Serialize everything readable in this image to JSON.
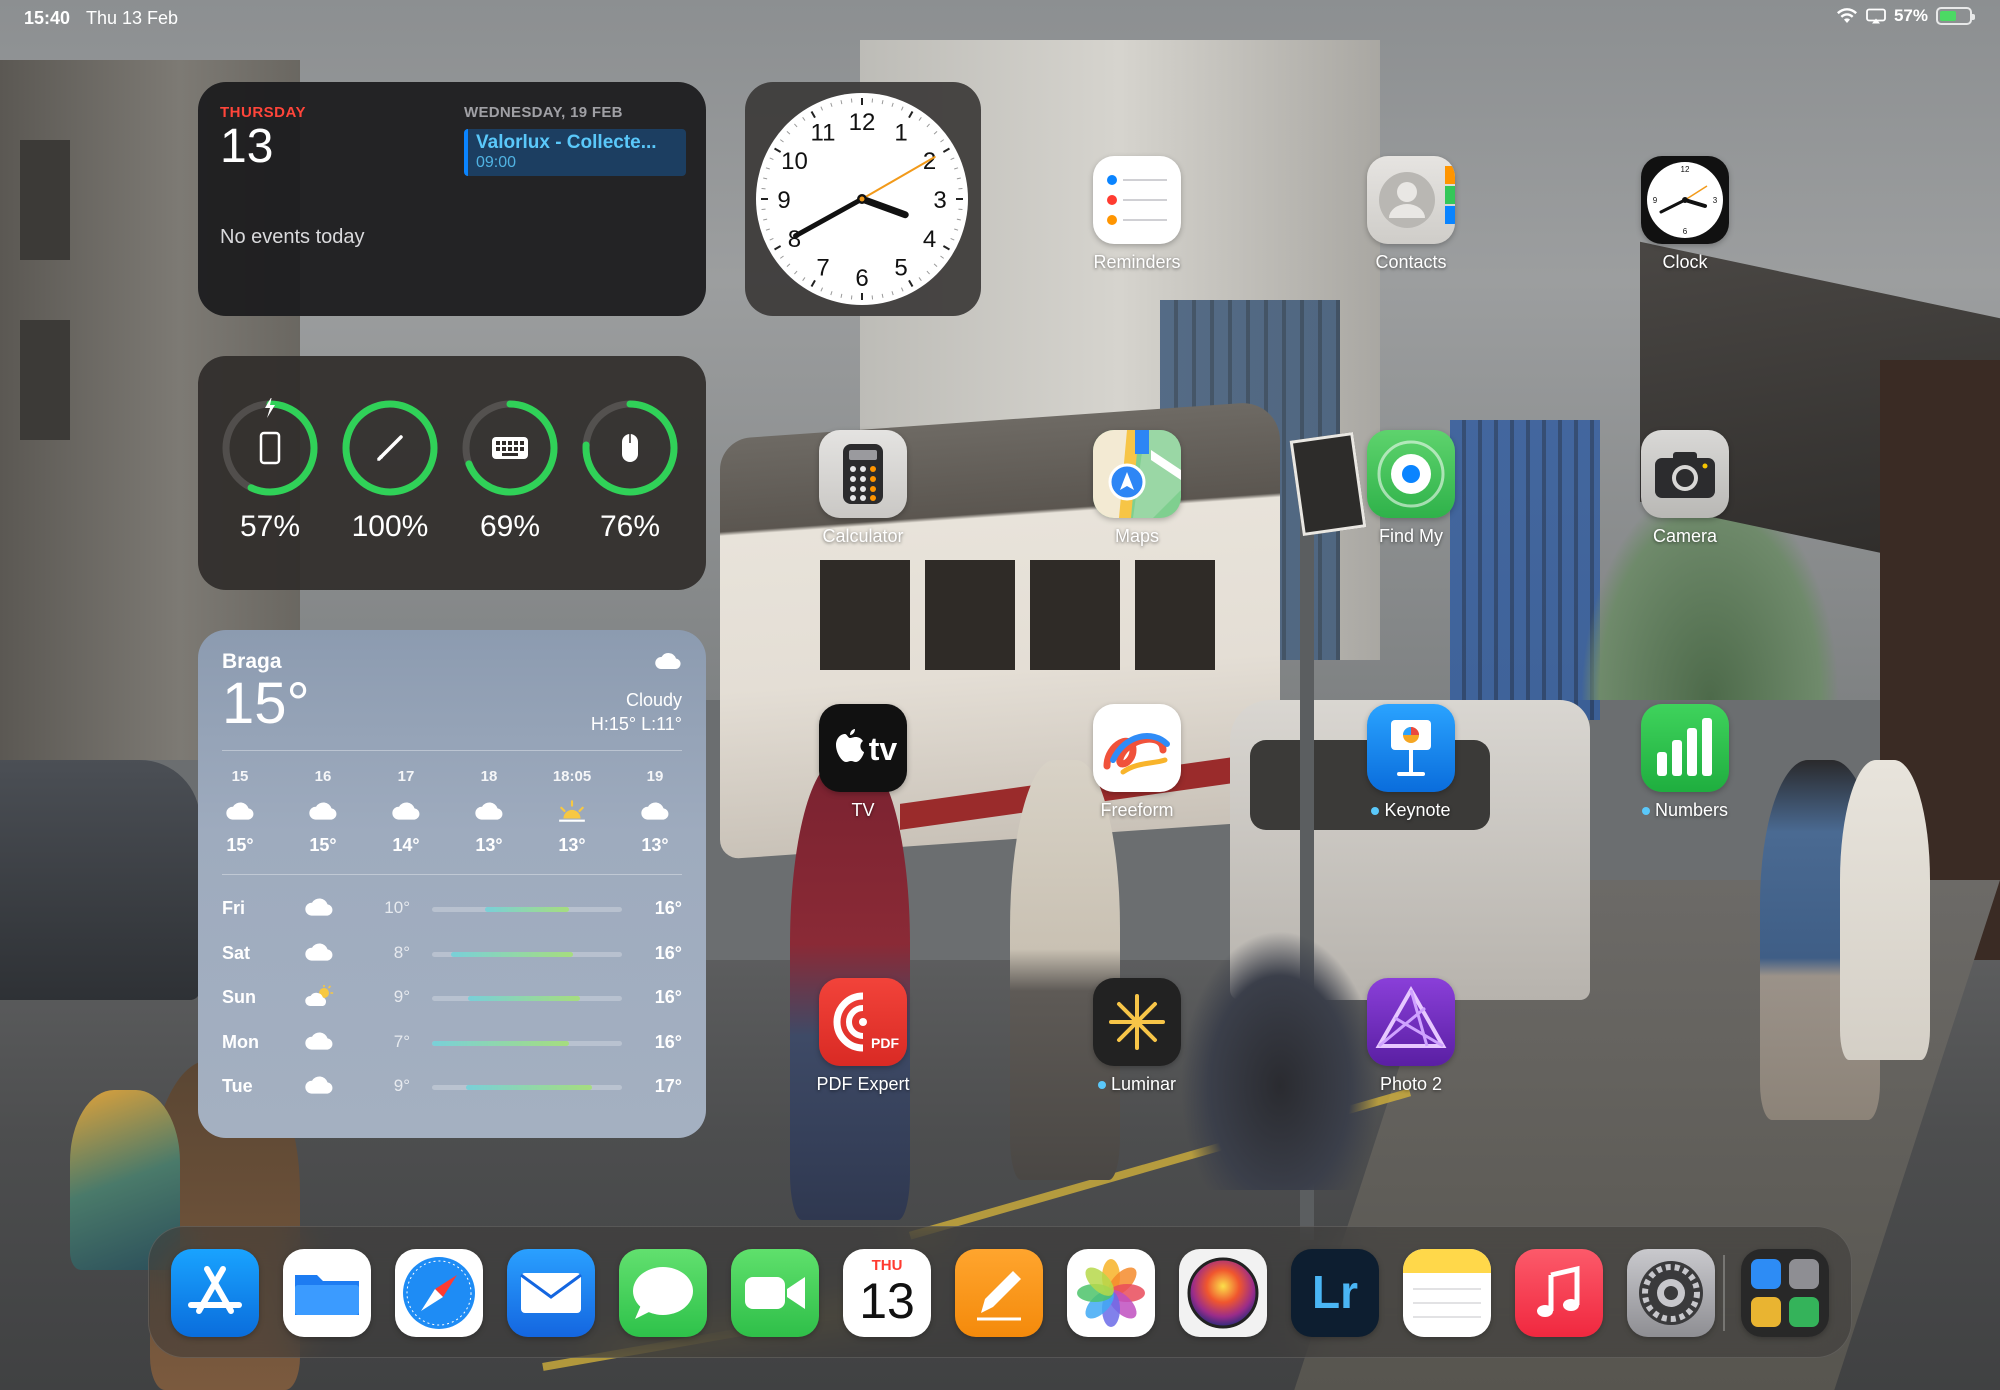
{
  "status_bar": {
    "time": "15:40",
    "date": "Thu 13 Feb",
    "battery_pct": "57%",
    "battery_level": 0.57,
    "icons": [
      "wifi-icon",
      "screen-mirroring-icon",
      "battery-charging-icon"
    ]
  },
  "calendar_widget": {
    "day_name": "THURSDAY",
    "day_number": "13",
    "empty_text": "No events today",
    "upcoming_date": "WEDNESDAY, 19 FEB",
    "event_title": "Valorlux - Collecte...",
    "event_time": "09:00",
    "accent": "#ff453a",
    "event_color": "#0a84ff"
  },
  "clock_widget": {
    "numbers": [
      "12",
      "1",
      "2",
      "3",
      "4",
      "5",
      "6",
      "7",
      "8",
      "9",
      "10",
      "11"
    ],
    "hour": 15,
    "minute": 40,
    "second": 10
  },
  "batteries_widget": {
    "devices": [
      {
        "name": "ipad-icon",
        "pct_text": "57%",
        "level": 0.57,
        "charging": true
      },
      {
        "name": "pencil-icon",
        "pct_text": "100%",
        "level": 1.0,
        "charging": false
      },
      {
        "name": "keyboard-icon",
        "pct_text": "69%",
        "level": 0.69,
        "charging": false
      },
      {
        "name": "mouse-icon",
        "pct_text": "76%",
        "level": 0.76,
        "charging": false
      }
    ],
    "ring_color": "#30d158"
  },
  "weather_widget": {
    "city": "Braga",
    "temperature": "15°",
    "condition": "Cloudy",
    "high_low": "H:15° L:11°",
    "hourly": [
      {
        "time": "15",
        "icon": "cloud-icon",
        "temp": "15°"
      },
      {
        "time": "16",
        "icon": "cloud-icon",
        "temp": "15°"
      },
      {
        "time": "17",
        "icon": "cloud-icon",
        "temp": "14°"
      },
      {
        "time": "18",
        "icon": "cloud-icon",
        "temp": "13°"
      },
      {
        "time": "18:05",
        "icon": "sunset-icon",
        "temp": "13°"
      },
      {
        "time": "19",
        "icon": "cloud-icon",
        "temp": "13°"
      }
    ],
    "daily": [
      {
        "day": "Fri",
        "icon": "cloud-icon",
        "low": "10°",
        "high": "16°",
        "range_start": 0.28,
        "range_end": 0.72
      },
      {
        "day": "Sat",
        "icon": "cloud-icon",
        "low": "8°",
        "high": "16°",
        "range_start": 0.1,
        "range_end": 0.74
      },
      {
        "day": "Sun",
        "icon": "partly-sunny-icon",
        "low": "9°",
        "high": "16°",
        "range_start": 0.19,
        "range_end": 0.78
      },
      {
        "day": "Mon",
        "icon": "cloud-icon",
        "low": "7°",
        "high": "16°",
        "range_start": 0.0,
        "range_end": 0.72
      },
      {
        "day": "Tue",
        "icon": "cloud-icon",
        "low": "9°",
        "high": "17°",
        "range_start": 0.18,
        "range_end": 0.84
      }
    ]
  },
  "apps": {
    "reminders": {
      "label": "Reminders"
    },
    "contacts": {
      "label": "Contacts"
    },
    "clock": {
      "label": "Clock"
    },
    "calculator": {
      "label": "Calculator"
    },
    "maps": {
      "label": "Maps"
    },
    "find_my": {
      "label": "Find My"
    },
    "camera": {
      "label": "Camera"
    },
    "tv": {
      "label": "TV",
      "icon_text": "tv"
    },
    "freeform": {
      "label": "Freeform"
    },
    "keynote": {
      "label": "Keynote",
      "new_dot": true
    },
    "numbers": {
      "label": "Numbers",
      "new_dot": true
    },
    "pdf_expert": {
      "label": "PDF Expert",
      "icon_text": "PDF"
    },
    "luminar": {
      "label": "Luminar",
      "new_dot": true
    },
    "photo2": {
      "label": "Photo 2"
    }
  },
  "dock": {
    "calendar_day": "THU",
    "calendar_num": "13",
    "lightroom_text": "Lr",
    "items": [
      "app-store-icon",
      "files-icon",
      "safari-icon",
      "mail-icon",
      "messages-icon",
      "facetime-icon",
      "calendar-icon",
      "pages-icon",
      "photos-icon",
      "color-app-icon",
      "lightroom-icon",
      "notes-icon",
      "music-icon",
      "settings-icon",
      "app-library-icon"
    ]
  }
}
